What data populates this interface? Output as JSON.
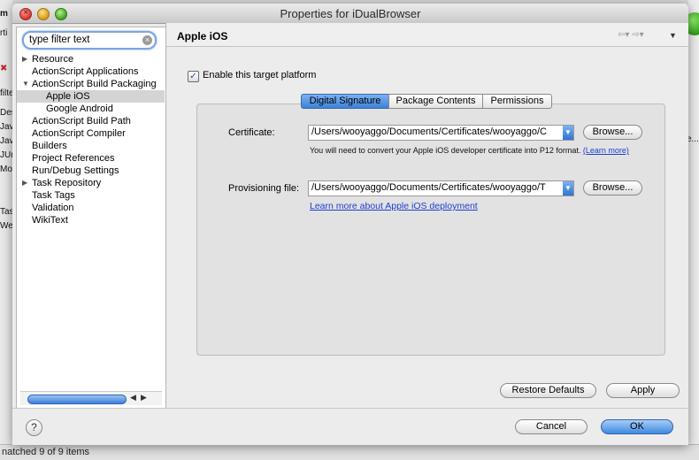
{
  "window": {
    "title": "Properties for iDualBrowser"
  },
  "filter": {
    "placeholder": "type filter text"
  },
  "tree": {
    "items": [
      {
        "label": "Resource",
        "expander": "▶"
      },
      {
        "label": "ActionScript Applications",
        "expander": ""
      },
      {
        "label": "ActionScript Build Packaging",
        "expander": "▼"
      },
      {
        "label": "Apple iOS",
        "expander": ""
      },
      {
        "label": "Google Android",
        "expander": ""
      },
      {
        "label": "ActionScript Build Path",
        "expander": ""
      },
      {
        "label": "ActionScript Compiler",
        "expander": ""
      },
      {
        "label": "Builders",
        "expander": ""
      },
      {
        "label": "Project References",
        "expander": ""
      },
      {
        "label": "Run/Debug Settings",
        "expander": ""
      },
      {
        "label": "Task Repository",
        "expander": "▶"
      },
      {
        "label": "Task Tags",
        "expander": ""
      },
      {
        "label": "Validation",
        "expander": ""
      },
      {
        "label": "WikiText",
        "expander": ""
      }
    ],
    "selected": "Apple iOS"
  },
  "page": {
    "title": "Apple iOS",
    "enable_label": "Enable this target platform",
    "enable_checked": true
  },
  "tabs": [
    "Digital Signature",
    "Package Contents",
    "Permissions"
  ],
  "active_tab": "Digital Signature",
  "certificate": {
    "label": "Certificate:",
    "value": "/Users/wooyaggo/Documents/Certificates/wooyaggo/C",
    "browse": "Browse...",
    "note": "You will need to convert your Apple iOS developer certificate into P12 format.",
    "learn_more": "(Learn more)"
  },
  "provisioning": {
    "label": "Provisioning file:",
    "value": "/Users/wooyaggo/Documents/Certificates/wooyaggo/T",
    "browse": "Browse...",
    "link": "Learn more about Apple iOS deployment"
  },
  "buttons": {
    "restore": "Restore Defaults",
    "apply": "Apply",
    "cancel": "Cancel",
    "ok": "OK"
  },
  "background": {
    "status_text": "natched 9 of 9 items",
    "left_fragments": [
      "m",
      "rti",
      "filte",
      "Des",
      "Java",
      "Java",
      "JUni",
      "Mo",
      "Tas",
      "Wel"
    ],
    "right_fragments": [
      "e...",
      "rt"
    ]
  },
  "colors": {
    "accent": "#3b82d8",
    "selection": "#d4d4d4",
    "link": "#1a3fd0"
  }
}
